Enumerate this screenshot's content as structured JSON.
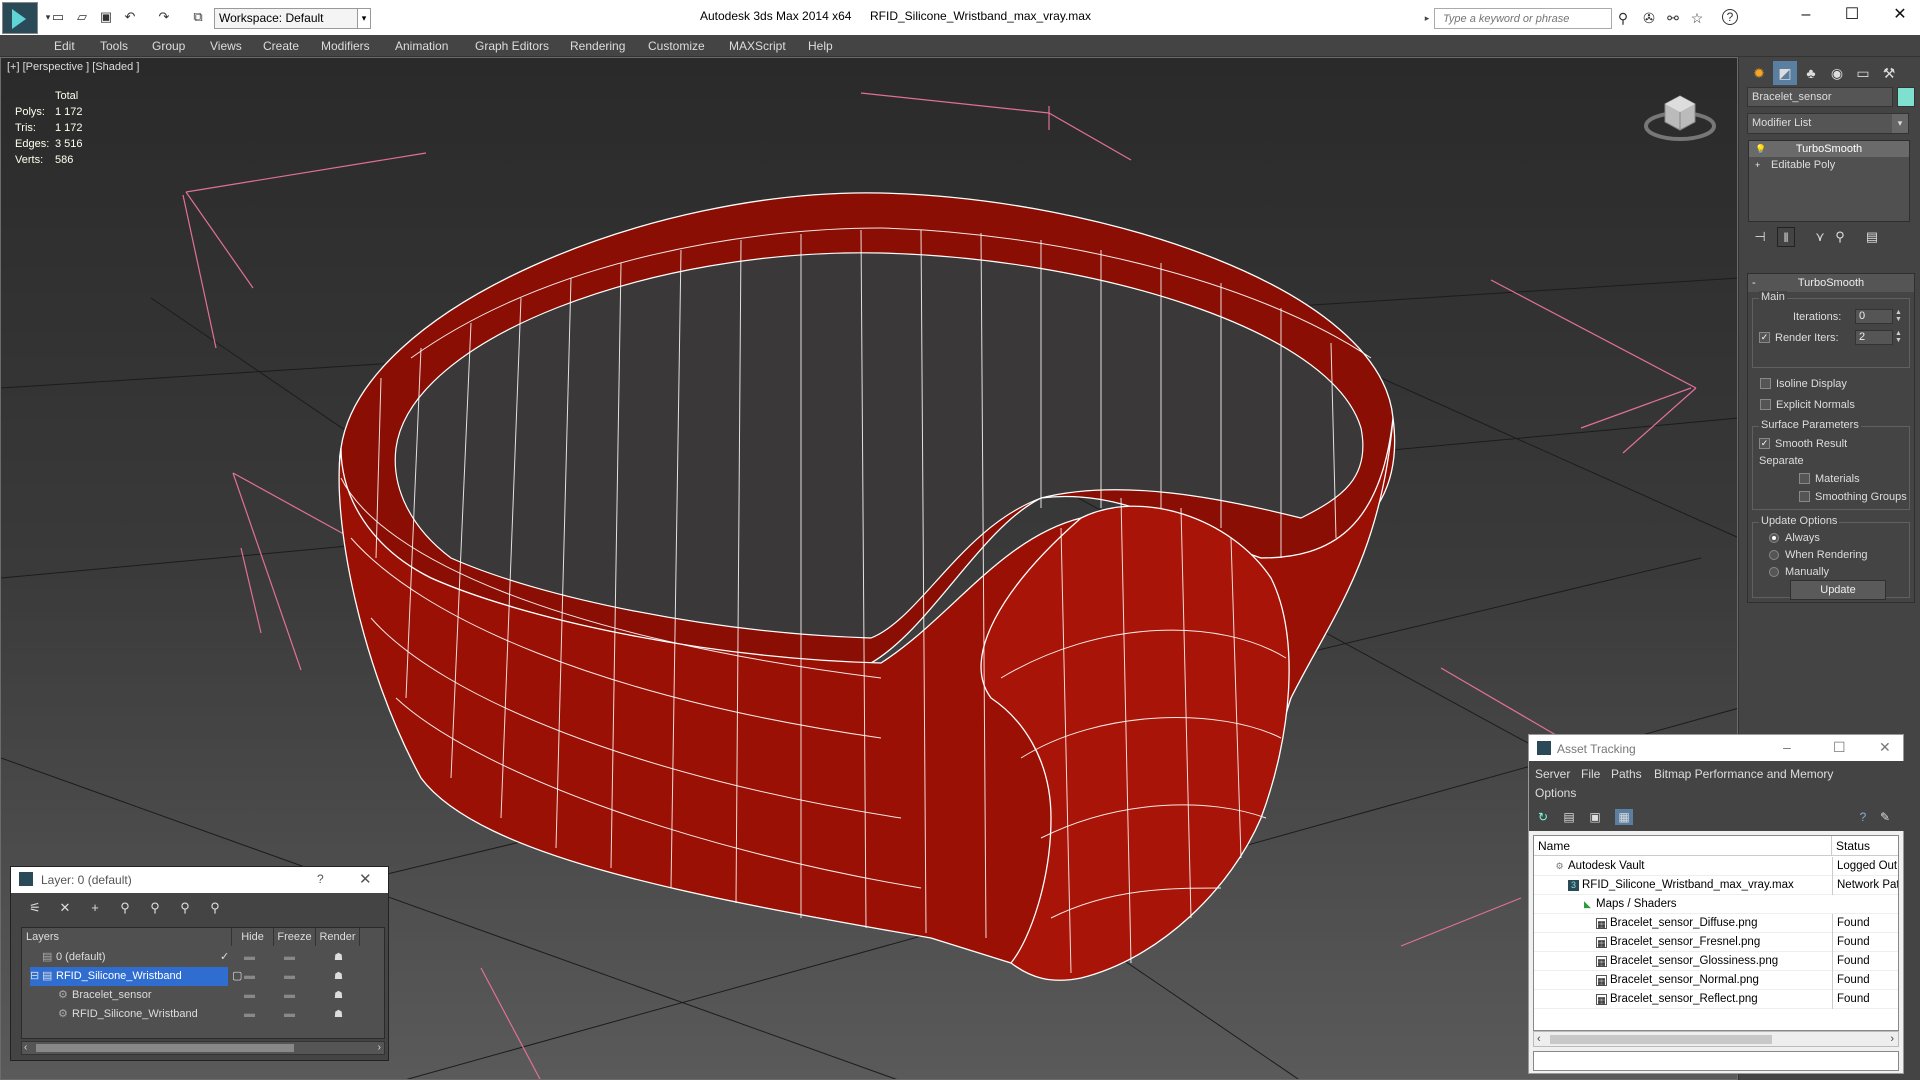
{
  "titlebar": {
    "app_title": "Autodesk 3ds Max  2014 x64",
    "file_title": "RFID_Silicone_Wristband_max_vray.max",
    "workspace": "Workspace: Default",
    "search_placeholder": "Type a keyword or phrase"
  },
  "menubar": {
    "items": [
      "Edit",
      "Tools",
      "Group",
      "Views",
      "Create",
      "Modifiers",
      "Animation",
      "Graph Editors",
      "Rendering",
      "Customize",
      "MAXScript",
      "Help"
    ]
  },
  "viewport": {
    "label": "[+] [Perspective ] [Shaded ]",
    "stats": {
      "header": "Total",
      "rows": [
        {
          "k": "Polys:",
          "v": "1 172"
        },
        {
          "k": "Tris:",
          "v": "1 172"
        },
        {
          "k": "Edges:",
          "v": "3 516"
        },
        {
          "k": "Verts:",
          "v": "586"
        }
      ]
    },
    "colors": {
      "mesh": "#9a1005",
      "wire": "#ffffff",
      "helper": "#e0709a"
    }
  },
  "command_panel": {
    "object_name": "Bracelet_sensor",
    "modifier_list": "Modifier List",
    "stack": [
      "TurboSmooth",
      "Editable Poly"
    ],
    "rollout_title": "TurboSmooth",
    "main_group": "Main",
    "iterations_label": "Iterations:",
    "iterations_value": "0",
    "render_iters_label": "Render Iters:",
    "render_iters_value": "2",
    "render_iters_checked": true,
    "isoline_label": "Isoline Display",
    "explicit_normals_label": "Explicit Normals",
    "surface_group": "Surface Parameters",
    "smooth_result_label": "Smooth Result",
    "smooth_result_checked": true,
    "separate_label": "Separate",
    "materials_label": "Materials",
    "smoothing_groups_label": "Smoothing Groups",
    "update_group": "Update Options",
    "always_label": "Always",
    "when_rendering_label": "When Rendering",
    "manually_label": "Manually",
    "update_button": "Update"
  },
  "layer_window": {
    "title": "Layer: 0 (default)",
    "help": "?",
    "columns": [
      "Layers",
      "Hide",
      "Freeze",
      "Render"
    ],
    "rows": [
      {
        "name": "0 (default)"
      },
      {
        "name": "RFID_Silicone_Wristband"
      },
      {
        "name": "Bracelet_sensor"
      },
      {
        "name": "RFID_Silicone_Wristband"
      }
    ]
  },
  "asset_window": {
    "title": "Asset Tracking",
    "menu": [
      "Server",
      "File",
      "Paths",
      "Bitmap Performance and Memory",
      "Options"
    ],
    "columns": [
      "Name",
      "Status"
    ],
    "rows": [
      {
        "name": "Autodesk Vault",
        "status": "Logged Out"
      },
      {
        "name": "RFID_Silicone_Wristband_max_vray.max",
        "status": "Network Pat"
      },
      {
        "name": "Maps / Shaders",
        "status": ""
      },
      {
        "name": "Bracelet_sensor_Diffuse.png",
        "status": "Found"
      },
      {
        "name": "Bracelet_sensor_Fresnel.png",
        "status": "Found"
      },
      {
        "name": "Bracelet_sensor_Glossiness.png",
        "status": "Found"
      },
      {
        "name": "Bracelet_sensor_Normal.png",
        "status": "Found"
      },
      {
        "name": "Bracelet_sensor_Reflect.png",
        "status": "Found"
      }
    ]
  }
}
